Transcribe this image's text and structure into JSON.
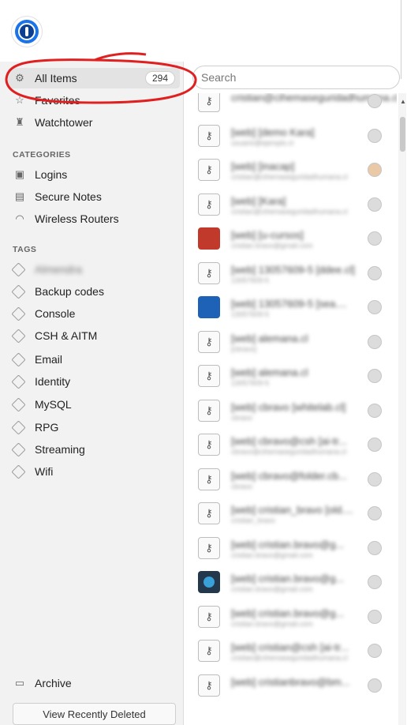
{
  "search": {
    "placeholder": "Search"
  },
  "sidebar": {
    "all_items": {
      "label": "All Items",
      "count": "294"
    },
    "favorites": "Favorites",
    "watchtower": "Watchtower",
    "categories_title": "CATEGORIES",
    "categories": [
      "Logins",
      "Secure Notes",
      "Wireless Routers"
    ],
    "tags_title": "TAGS",
    "tags": [
      "Almendra",
      "Backup codes",
      "Console",
      "CSH & AITM",
      "Email",
      "Identity",
      "MySQL",
      "RPG",
      "Streaming",
      "Wifi"
    ],
    "archive": "Archive",
    "view_recently_deleted": "View Recently Deleted"
  },
  "items": [
    {
      "title": "cristian@cihemaseguridadhumana.cl",
      "sub": ""
    },
    {
      "title": "[web] [demo Kara]",
      "sub": "usuario@ejemplo.cl"
    },
    {
      "title": "[web] [inacap]",
      "sub": "cristian@cihemaseguridadhumana.cl"
    },
    {
      "title": "[web] [Kara]",
      "sub": "cristian@cihemaseguridadhumana.cl"
    },
    {
      "title": "[web] [u-cursos]",
      "sub": "cristian.bravo@gmail.com"
    },
    {
      "title": "[web] 13057609-5 [ddee.cl]",
      "sub": "13057609-5"
    },
    {
      "title": "[web] 13057609-5 [sea....",
      "sub": "13057609-5"
    },
    {
      "title": "[web] alemana.cl",
      "sub": "[cbravo]"
    },
    {
      "title": "[web] alemana.cl",
      "sub": "13057609-5"
    },
    {
      "title": "[web] cbravo [whitelab.cl]",
      "sub": "cbravo"
    },
    {
      "title": "[web] cbravo@csh [ai-tr...",
      "sub": "cbravo@cihemaseguridadhumana.cl"
    },
    {
      "title": "[web] cbravo@folder.cb...",
      "sub": "cbravo"
    },
    {
      "title": "[web] cristian_bravo [old....",
      "sub": "cristian_bravo"
    },
    {
      "title": "[web] cristian.bravo@g...",
      "sub": "cristian.bravo@gmail.com"
    },
    {
      "title": "[web] cristian.bravo@g...",
      "sub": "cristian.bravo@gmail.com"
    },
    {
      "title": "[web] cristian.bravo@g...",
      "sub": "cristian.bravo@gmail.com"
    },
    {
      "title": "[web] cristian@csh [ai-tr...",
      "sub": "cristian@cihemaseguridadhumana.cl"
    },
    {
      "title": "[web] cristianbravo@bm...",
      "sub": ""
    }
  ]
}
